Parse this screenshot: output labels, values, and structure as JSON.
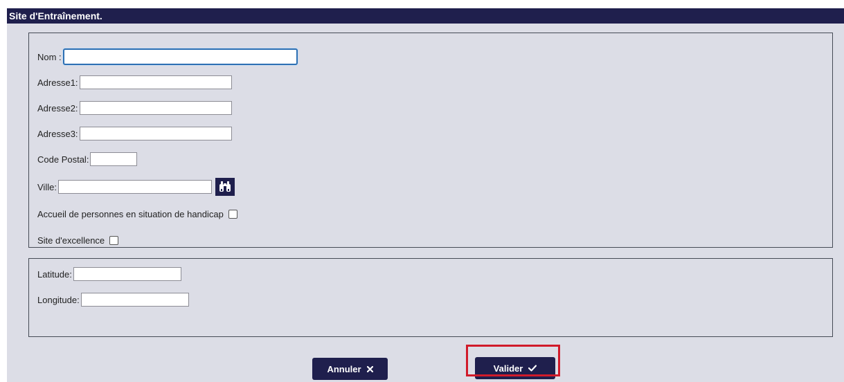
{
  "title": "Site d'Entraînement.",
  "form": {
    "nom_label": "Nom :",
    "nom_value": "",
    "adresse1_label": "Adresse1:",
    "adresse1_value": "",
    "adresse2_label": "Adresse2:",
    "adresse2_value": "",
    "adresse3_label": "Adresse3:",
    "adresse3_value": "",
    "code_postal_label": "Code Postal:",
    "code_postal_value": "",
    "ville_label": "Ville:",
    "ville_value": "",
    "handicap_label": "Accueil de personnes en situation de handicap",
    "handicap_checked": false,
    "excellence_label": "Site d'excellence",
    "excellence_checked": false
  },
  "geo": {
    "latitude_label": "Latitude:",
    "latitude_value": "",
    "longitude_label": "Longitude:",
    "longitude_value": ""
  },
  "buttons": {
    "cancel_label": "Annuler",
    "cancel_icon": "close-icon",
    "validate_label": "Valider",
    "validate_icon": "checkmark-icon"
  },
  "colors": {
    "navy": "#1f1f4d",
    "panel_bg": "#dcdde6",
    "focus_blue": "#2d6fb3",
    "highlight_red": "#d11a2a"
  },
  "icons": {
    "city_search": "binoculars-icon"
  }
}
